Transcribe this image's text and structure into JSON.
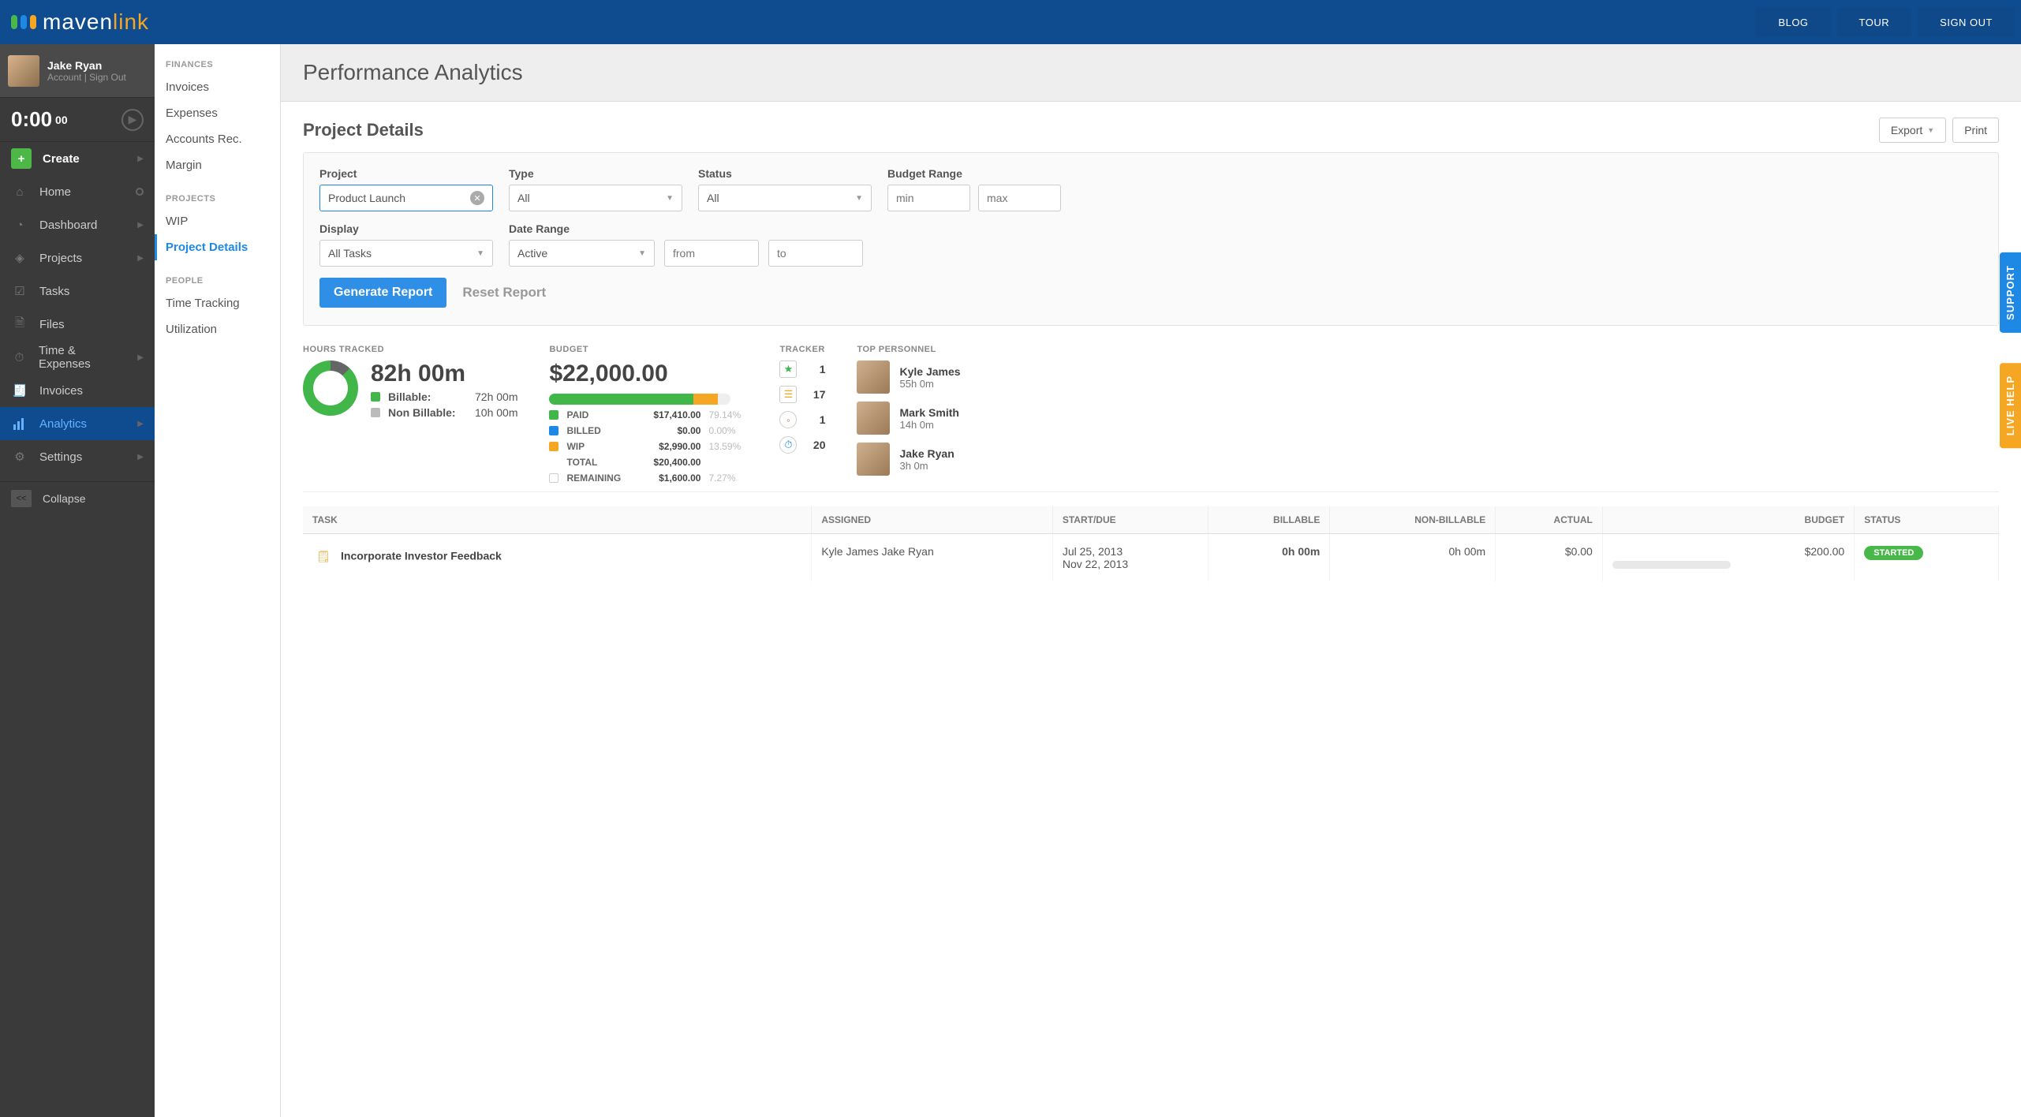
{
  "brand": {
    "name_a": "maven",
    "name_b": "link"
  },
  "topbar": {
    "blog": "BLOG",
    "tour": "TOUR",
    "signout": "SIGN OUT"
  },
  "user": {
    "name": "Jake Ryan",
    "links": "Account | Sign Out"
  },
  "timer": {
    "main": "0:00",
    "sub": "00"
  },
  "nav": {
    "create": "Create",
    "home": "Home",
    "dashboard": "Dashboard",
    "projects": "Projects",
    "tasks": "Tasks",
    "files": "Files",
    "time_expenses": "Time & Expenses",
    "invoices": "Invoices",
    "analytics": "Analytics",
    "settings": "Settings",
    "collapse": "Collapse"
  },
  "subnav": {
    "finances_hd": "FINANCES",
    "finances": {
      "invoices": "Invoices",
      "expenses": "Expenses",
      "accounts_rec": "Accounts Rec.",
      "margin": "Margin"
    },
    "projects_hd": "PROJECTS",
    "projects": {
      "wip": "WIP",
      "project_details": "Project Details"
    },
    "people_hd": "PEOPLE",
    "people": {
      "time_tracking": "Time Tracking",
      "utilization": "Utilization"
    }
  },
  "page": {
    "title": "Performance Analytics"
  },
  "section": {
    "title": "Project Details",
    "export": "Export",
    "print": "Print"
  },
  "filters": {
    "project_label": "Project",
    "project_value": "Product Launch",
    "type_label": "Type",
    "type_value": "All",
    "status_label": "Status",
    "status_value": "All",
    "budget_label": "Budget Range",
    "min_ph": "min",
    "max_ph": "max",
    "display_label": "Display",
    "display_value": "All Tasks",
    "daterange_label": "Date Range",
    "daterange_value": "Active",
    "from_ph": "from",
    "to_ph": "to",
    "generate": "Generate Report",
    "reset": "Reset Report"
  },
  "summary": {
    "hours_label": "HOURS TRACKED",
    "hours_total": "82h 00m",
    "billable_label": "Billable:",
    "billable_val": "72h 00m",
    "nonbillable_label": "Non Billable:",
    "nonbillable_val": "10h 00m",
    "budget_label": "BUDGET",
    "budget_total": "$22,000.00",
    "paid": {
      "label": "PAID",
      "amt": "$17,410.00",
      "pct": "79.14%"
    },
    "billed": {
      "label": "BILLED",
      "amt": "$0.00",
      "pct": "0.00%"
    },
    "wip": {
      "label": "WIP",
      "amt": "$2,990.00",
      "pct": "13.59%"
    },
    "total": {
      "label": "TOTAL",
      "amt": "$20,400.00"
    },
    "remaining": {
      "label": "REMAINING",
      "amt": "$1,600.00",
      "pct": "7.27%"
    },
    "tracker_label": "TRACKER",
    "tracker": {
      "a": "1",
      "b": "17",
      "c": "1",
      "d": "20"
    },
    "personnel_label": "TOP PERSONNEL",
    "personnel": [
      {
        "name": "Kyle James",
        "hrs": "55h 0m"
      },
      {
        "name": "Mark Smith",
        "hrs": "14h 0m"
      },
      {
        "name": "Jake Ryan",
        "hrs": "3h 0m"
      }
    ]
  },
  "table": {
    "headers": {
      "task": "TASK",
      "assigned": "ASSIGNED",
      "startdue": "START/DUE",
      "billable": "BILLABLE",
      "nonbillable": "NON-BILLABLE",
      "actual": "ACTUAL",
      "budget": "BUDGET",
      "status": "STATUS"
    },
    "rows": [
      {
        "task": "Incorporate Investor Feedback",
        "assigned": "Kyle James Jake Ryan",
        "startdue": "Jul 25, 2013\nNov 22, 2013",
        "billable": "0h 00m",
        "nonbillable": "0h 00m",
        "actual": "$0.00",
        "budget": "$200.00",
        "status": "STARTED"
      }
    ]
  },
  "sidetabs": {
    "support": "SUPPORT",
    "livehelp": "LIVE HELP"
  },
  "chart_data": {
    "donut": {
      "type": "pie",
      "title": "Hours Tracked",
      "series": [
        {
          "name": "Billable",
          "value": 72
        },
        {
          "name": "Non Billable",
          "value": 10
        }
      ],
      "total_label": "82h 00m"
    },
    "budget_bar": {
      "type": "bar",
      "title": "Budget $22,000.00",
      "segments": [
        {
          "name": "PAID",
          "value": 17410,
          "pct": 79.14
        },
        {
          "name": "BILLED",
          "value": 0,
          "pct": 0
        },
        {
          "name": "WIP",
          "value": 2990,
          "pct": 13.59
        },
        {
          "name": "REMAINING",
          "value": 1600,
          "pct": 7.27
        }
      ],
      "total": 20400
    }
  }
}
